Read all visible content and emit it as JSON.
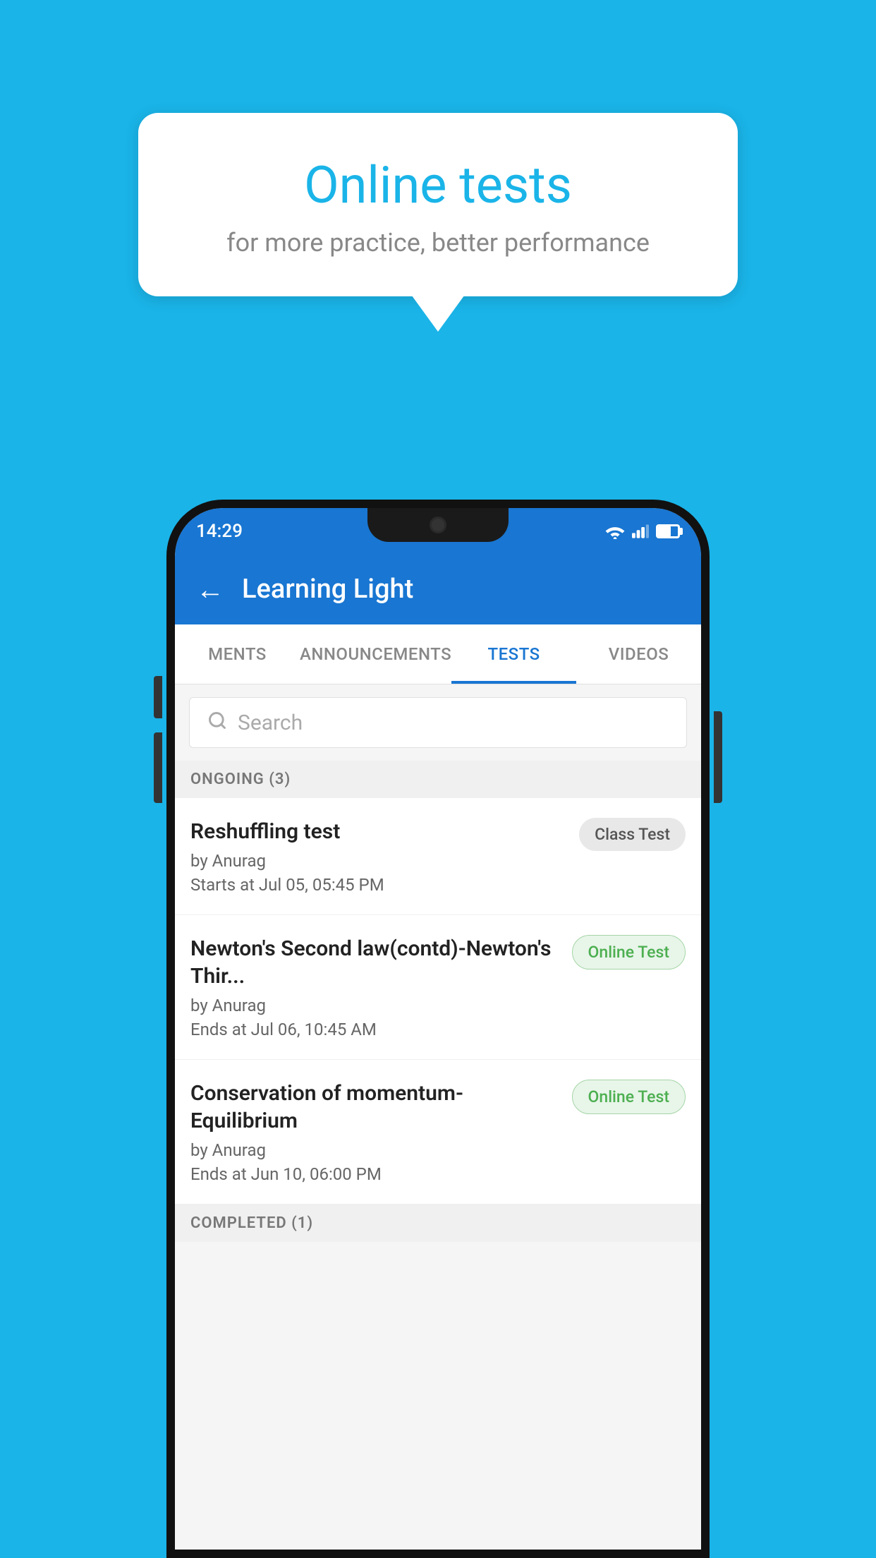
{
  "background_color": "#1ab4e8",
  "speech_bubble": {
    "title": "Online tests",
    "subtitle": "for more practice, better performance"
  },
  "phone": {
    "status_bar": {
      "time": "14:29",
      "icons": [
        "wifi",
        "signal",
        "battery"
      ]
    },
    "app_bar": {
      "title": "Learning Light",
      "back_label": "←"
    },
    "tabs": [
      {
        "label": "MENTS",
        "active": false
      },
      {
        "label": "ANNOUNCEMENTS",
        "active": false
      },
      {
        "label": "TESTS",
        "active": true
      },
      {
        "label": "VIDEOS",
        "active": false
      }
    ],
    "search": {
      "placeholder": "Search"
    },
    "sections": [
      {
        "label": "ONGOING (3)",
        "tests": [
          {
            "name": "Reshuffling test",
            "author": "by Anurag",
            "time": "Starts at  Jul 05, 05:45 PM",
            "badge": "Class Test",
            "badge_type": "class"
          },
          {
            "name": "Newton's Second law(contd)-Newton's Thir...",
            "author": "by Anurag",
            "time": "Ends at  Jul 06, 10:45 AM",
            "badge": "Online Test",
            "badge_type": "online"
          },
          {
            "name": "Conservation of momentum-Equilibrium",
            "author": "by Anurag",
            "time": "Ends at  Jun 10, 06:00 PM",
            "badge": "Online Test",
            "badge_type": "online"
          }
        ]
      },
      {
        "label": "COMPLETED (1)",
        "tests": []
      }
    ]
  }
}
